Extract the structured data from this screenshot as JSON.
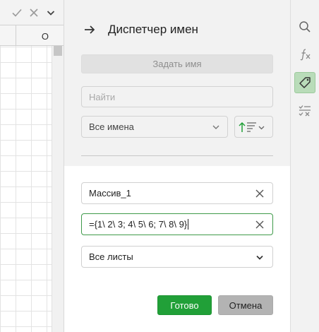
{
  "formula_bar": {
    "accept_icon": "check-icon",
    "cancel_icon": "x-icon",
    "expand_icon": "chevron-down-icon"
  },
  "sheet": {
    "column_label": "O"
  },
  "panel": {
    "title": "Диспетчер имен",
    "back_icon": "arrow-right-icon",
    "define_name_label": "Задать имя",
    "search_placeholder": "Найти",
    "filter_value": "Все имена",
    "sort_icon": "sort-ascending-icon",
    "name_value": "Массив_1",
    "formula_value": "={1\\ 2\\ 3; 4\\ 5\\ 6; 7\\ 8\\ 9}",
    "scope_value": "Все листы",
    "ok_label": "Готово",
    "cancel_label": "Отмена"
  },
  "toolbar": {
    "items": [
      "search-icon",
      "function-icon",
      "tag-icon",
      "checklist-clear-icon"
    ],
    "active": "tag-icon"
  },
  "colors": {
    "accent": "#21a038",
    "active_rail": "#b9dcb9",
    "panel_bg": "#f2f2f2"
  }
}
